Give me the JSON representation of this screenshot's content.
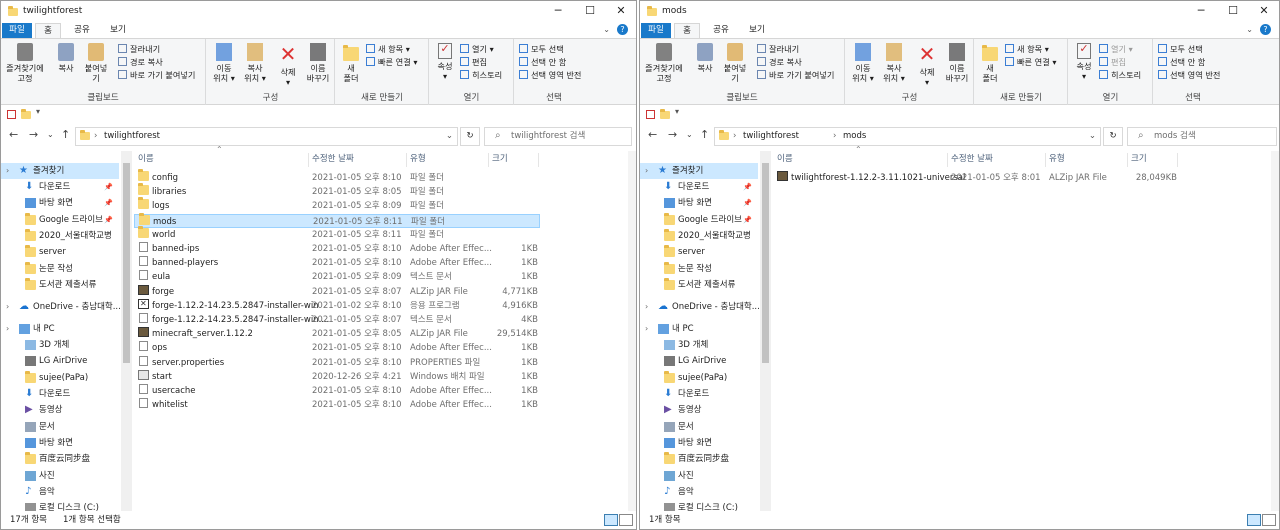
{
  "windows": [
    {
      "title": "twilightforest",
      "tabs": {
        "file": "파일",
        "home": "홈",
        "share": "공유",
        "view": "보기"
      },
      "ribbon": {
        "clipboard": {
          "pin": "즐겨찾기에\n고정",
          "copy": "복사",
          "paste": "붙여넣기",
          "cut": "잘라내기",
          "copy_path": "경로 복사",
          "paste_shortcut": "바로 가기 붙여넣기",
          "label": "클립보드"
        },
        "organize": {
          "move": "이동\n위치 ▾",
          "copyto": "복사\n위치 ▾",
          "delete": "삭제\n▾",
          "rename": "이름\n바꾸기",
          "label": "구성"
        },
        "new": {
          "new_folder": "새\n폴더",
          "new_item": "새 항목 ▾",
          "easy_access": "빠른 연결 ▾",
          "label": "새로 만들기"
        },
        "open": {
          "properties": "속성\n▾",
          "open": "열기 ▾",
          "edit": "편집",
          "history": "히스토리",
          "label": "열기"
        },
        "select": {
          "all": "모두 선택",
          "none": "선택 안 함",
          "invert": "선택 영역 반전",
          "label": "선택"
        }
      },
      "address": {
        "breadcrumb": [
          "twilightforest"
        ],
        "search_placeholder": "twilightforest 검색"
      },
      "columns": {
        "name": "이름",
        "date": "수정한 날짜",
        "type": "유형",
        "size": "크기"
      },
      "files": [
        {
          "name": "config",
          "date": "2021-01-05 오후 8:10",
          "type": "파일 폴더",
          "size": "",
          "icon": "folder"
        },
        {
          "name": "libraries",
          "date": "2021-01-05 오후 8:05",
          "type": "파일 폴더",
          "size": "",
          "icon": "folder"
        },
        {
          "name": "logs",
          "date": "2021-01-05 오후 8:09",
          "type": "파일 폴더",
          "size": "",
          "icon": "folder"
        },
        {
          "name": "mods",
          "date": "2021-01-05 오후 8:11",
          "type": "파일 폴더",
          "size": "",
          "icon": "folder",
          "selected": true
        },
        {
          "name": "world",
          "date": "2021-01-05 오후 8:11",
          "type": "파일 폴더",
          "size": "",
          "icon": "folder"
        },
        {
          "name": "banned-ips",
          "date": "2021-01-05 오후 8:10",
          "type": "Adobe After Effec...",
          "size": "1KB",
          "icon": "doc"
        },
        {
          "name": "banned-players",
          "date": "2021-01-05 오후 8:10",
          "type": "Adobe After Effec...",
          "size": "1KB",
          "icon": "doc"
        },
        {
          "name": "eula",
          "date": "2021-01-05 오후 8:09",
          "type": "텍스트 문서",
          "size": "1KB",
          "icon": "doc"
        },
        {
          "name": "forge",
          "date": "2021-01-05 오후 8:07",
          "type": "ALZip JAR File",
          "size": "4,771KB",
          "icon": "jar"
        },
        {
          "name": "forge-1.12.2-14.23.5.2847-installer-win",
          "date": "2021-01-02 오후 8:10",
          "type": "응용 프로그램",
          "size": "4,916KB",
          "icon": "exe"
        },
        {
          "name": "forge-1.12.2-14.23.5.2847-installer-win....",
          "date": "2021-01-05 오후 8:07",
          "type": "텍스트 문서",
          "size": "4KB",
          "icon": "doc"
        },
        {
          "name": "minecraft_server.1.12.2",
          "date": "2021-01-05 오후 8:05",
          "type": "ALZip JAR File",
          "size": "29,514KB",
          "icon": "jar"
        },
        {
          "name": "ops",
          "date": "2021-01-05 오후 8:10",
          "type": "Adobe After Effec...",
          "size": "1KB",
          "icon": "doc"
        },
        {
          "name": "server.properties",
          "date": "2021-01-05 오후 8:10",
          "type": "PROPERTIES 파일",
          "size": "1KB",
          "icon": "doc"
        },
        {
          "name": "start",
          "date": "2020-12-26 오후 4:21",
          "type": "Windows 배치 파일",
          "size": "1KB",
          "icon": "bat"
        },
        {
          "name": "usercache",
          "date": "2021-01-05 오후 8:10",
          "type": "Adobe After Effec...",
          "size": "1KB",
          "icon": "doc"
        },
        {
          "name": "whitelist",
          "date": "2021-01-05 오후 8:10",
          "type": "Adobe After Effec...",
          "size": "1KB",
          "icon": "doc"
        }
      ],
      "status": {
        "count": "17개 항목",
        "selected": "1개 항목 선택함"
      }
    },
    {
      "title": "mods",
      "tabs": {
        "file": "파일",
        "home": "홈",
        "share": "공유",
        "view": "보기"
      },
      "ribbon": {
        "clipboard": {
          "pin": "즐겨찾기에\n고정",
          "copy": "복사",
          "paste": "붙여넣기",
          "cut": "잘라내기",
          "copy_path": "경로 복사",
          "paste_shortcut": "바로 가기 붙여넣기",
          "label": "클립보드"
        },
        "organize": {
          "move": "이동\n위치 ▾",
          "copyto": "복사\n위치 ▾",
          "delete": "삭제\n▾",
          "rename": "이름\n바꾸기",
          "label": "구성"
        },
        "new": {
          "new_folder": "새\n폴더",
          "new_item": "새 항목 ▾",
          "easy_access": "빠른 연결 ▾",
          "label": "새로 만들기"
        },
        "open": {
          "properties": "속성\n▾",
          "open": "열기 ▾",
          "edit": "편집",
          "history": "히스토리",
          "label": "열기"
        },
        "select": {
          "all": "모두 선택",
          "none": "선택 안 함",
          "invert": "선택 영역 반전",
          "label": "선택"
        }
      },
      "address": {
        "breadcrumb": [
          "twilightforest",
          "mods"
        ],
        "search_placeholder": "mods 검색"
      },
      "columns": {
        "name": "이름",
        "date": "수정한 날짜",
        "type": "유형",
        "size": "크기"
      },
      "files": [
        {
          "name": "twilightforest-1.12.2-3.11.1021-universal",
          "date": "2021-01-05 오후 8:01",
          "type": "ALZip JAR File",
          "size": "28,049KB",
          "icon": "jar"
        }
      ],
      "status": {
        "count": "1개 항목",
        "selected": ""
      }
    }
  ],
  "nav": [
    {
      "label": "즐겨찾기",
      "icon": "star-icon",
      "level": 0,
      "selected": true
    },
    {
      "label": "다운로드",
      "icon": "download-icon",
      "level": 1,
      "pinned": true
    },
    {
      "label": "바탕 화면",
      "icon": "desktop-icon",
      "level": 1,
      "pinned": true
    },
    {
      "label": "Google 드라이브",
      "icon": "folder-icon",
      "level": 1,
      "pinned": true
    },
    {
      "label": "2020_서울대학교병",
      "icon": "folder-icon",
      "level": 1
    },
    {
      "label": "server",
      "icon": "folder-icon",
      "level": 1
    },
    {
      "label": "논문 작성",
      "icon": "folder-icon",
      "level": 1
    },
    {
      "label": "도서관 제출서류",
      "icon": "folder-icon",
      "level": 1
    },
    {
      "label": "",
      "icon": "",
      "level": -1
    },
    {
      "label": "OneDrive - 충남대학...",
      "icon": "cloud-icon",
      "level": 0
    },
    {
      "label": "",
      "icon": "",
      "level": -1
    },
    {
      "label": "내 PC",
      "icon": "pc-icon",
      "level": 0
    },
    {
      "label": "3D 개체",
      "icon": "cube-icon",
      "level": 1
    },
    {
      "label": "LG AirDrive",
      "icon": "drive-icon",
      "level": 1
    },
    {
      "label": "sujee(PaPa)",
      "icon": "folder-icon",
      "level": 1
    },
    {
      "label": "다운로드",
      "icon": "download-icon",
      "level": 1
    },
    {
      "label": "동영상",
      "icon": "video-icon",
      "level": 1
    },
    {
      "label": "문서",
      "icon": "document-icon",
      "level": 1
    },
    {
      "label": "바탕 화면",
      "icon": "desktop-icon",
      "level": 1
    },
    {
      "label": "百度云同步盘",
      "icon": "folder-icon",
      "level": 1
    },
    {
      "label": "사진",
      "icon": "picture-icon",
      "level": 1
    },
    {
      "label": "음악",
      "icon": "music-icon",
      "level": 1
    },
    {
      "label": "로컬 디스크 (C:)",
      "icon": "disk-icon",
      "level": 1
    }
  ],
  "colors": {
    "accent": "#1979ca",
    "selection": "#cce8ff",
    "folder": "#f8d775"
  }
}
